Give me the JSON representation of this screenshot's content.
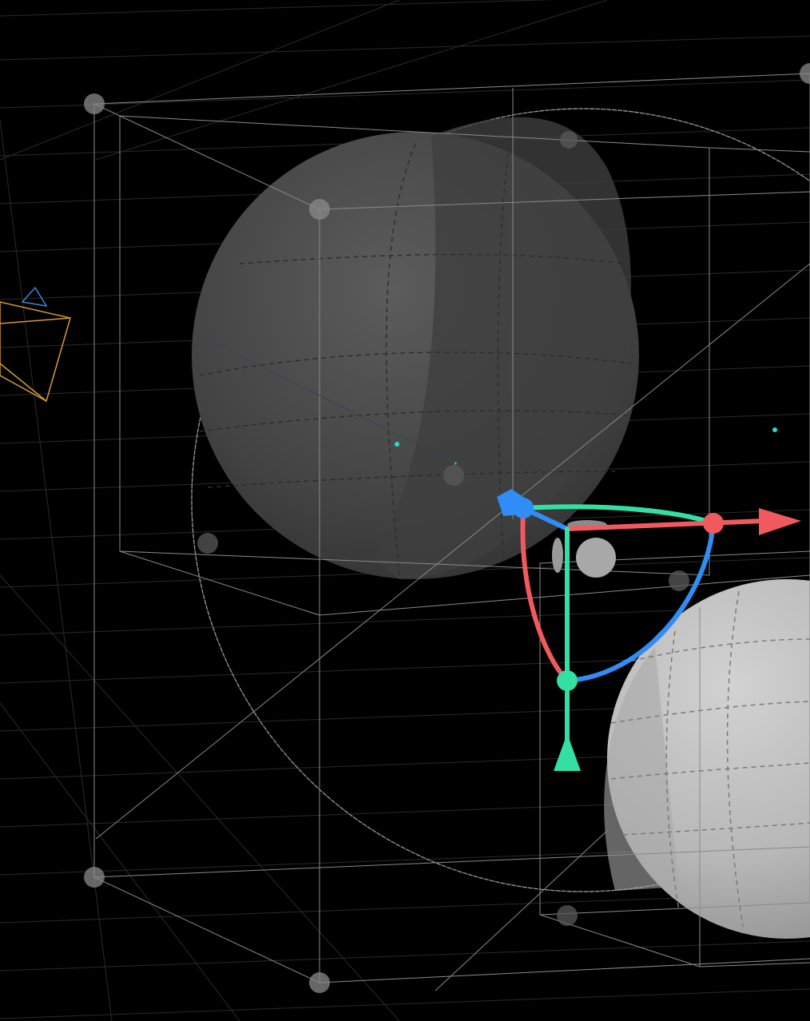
{
  "viewport": {
    "background": "#000000",
    "grid_color": "#2a2a2a",
    "wire_color": "#8a8a8a"
  },
  "objects": [
    {
      "name": "sphere-upper-left",
      "kind": "sphere",
      "fill": "#4a4a4a"
    },
    {
      "name": "sphere-lower-right",
      "kind": "sphere",
      "fill": "#b9b9b9"
    }
  ],
  "gizmo": {
    "x_axis_color": "#f05a5f",
    "y_axis_color": "#33dfa3",
    "z_axis_color": "#2f8df5"
  },
  "camera": {
    "frustum_color": "#d39a35",
    "up_indicator_color": "#3e86d8"
  },
  "light_markers": {
    "color": "#23e0c8",
    "count": 3
  }
}
